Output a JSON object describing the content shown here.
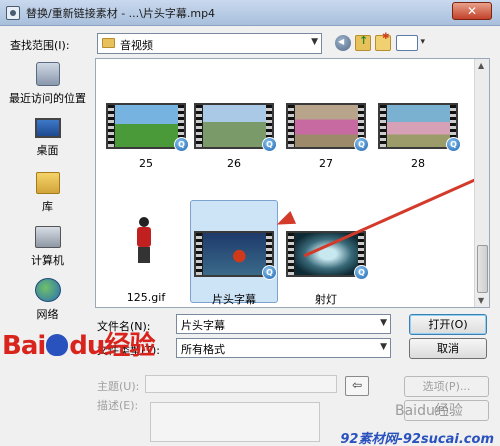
{
  "window": {
    "title": "替换/重新链接素材 - ...\\片头字幕.mp4",
    "close_symbol": "✕"
  },
  "lookin": {
    "label": "查找范围(I):",
    "value": "音视频"
  },
  "places": [
    {
      "label": "最近访问的位置",
      "icon": "recent-places-icon"
    },
    {
      "label": "桌面",
      "icon": "desktop-icon"
    },
    {
      "label": "库",
      "icon": "library-icon"
    },
    {
      "label": "计算机",
      "icon": "computer-icon"
    },
    {
      "label": "网络",
      "icon": "network-icon"
    }
  ],
  "files": [
    {
      "label": "25",
      "type": "video"
    },
    {
      "label": "26",
      "type": "video"
    },
    {
      "label": "27",
      "type": "video"
    },
    {
      "label": "28",
      "type": "video"
    },
    {
      "label": "125.gif",
      "type": "image"
    },
    {
      "label": "片头字幕",
      "type": "video",
      "selected": true
    },
    {
      "label": "射灯",
      "type": "video"
    }
  ],
  "form": {
    "filename_label": "文件名(N):",
    "filename_value": "片头字幕",
    "filetype_label": "文件类型(T):",
    "filetype_value": "所有格式",
    "subject_label": "主题(U):",
    "description_label": "描述(E):"
  },
  "buttons": {
    "open": "打开(O)",
    "cancel": "取消",
    "options": "选项(P)...",
    "browse": "(P)...",
    "extra": "Baidu经验"
  },
  "watermarks": {
    "baidu_left": "Bai",
    "baidu_right": "du",
    "baidu_jingyan": "经验",
    "corner": "92素材网-92sucai.com"
  },
  "colors": {
    "accent_red": "#d43a2a",
    "selection": "#cde4f7",
    "baidu_blue": "#2a52be"
  }
}
